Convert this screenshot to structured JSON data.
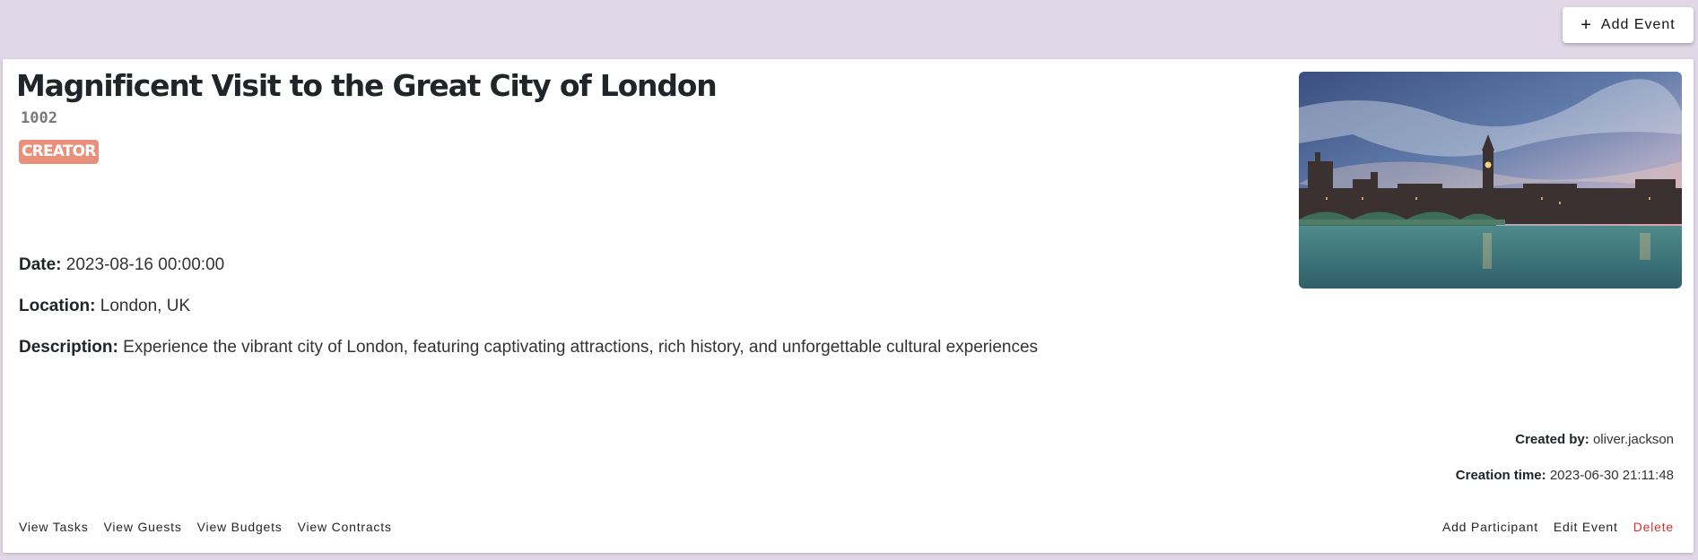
{
  "toolbar": {
    "add_event_icon": "plus-icon",
    "add_event_label": "Add Event"
  },
  "event": {
    "title": "Magnificent Visit to the Great City of London",
    "id": "1002",
    "role_badge": "CREATOR",
    "image_subject": "london-skyline-westminster-photo",
    "date_label": "Date:",
    "date_value": "2023-08-16 00:00:00",
    "location_label": "Location:",
    "location_value": "London, UK",
    "description_label": "Description:",
    "description_value": "Experience the vibrant city of London, featuring captivating attractions, rich history, and unforgettable cultural experiences",
    "created_by_label": "Created by:",
    "created_by_value": "oliver.jackson",
    "creation_time_label": "Creation time:",
    "creation_time_value": "2023-06-30 21:11:48"
  },
  "actions": {
    "left": [
      "View Tasks",
      "View Guests",
      "View Budgets",
      "View Contracts"
    ],
    "right": [
      "Add Participant",
      "Edit Event",
      "Delete"
    ]
  },
  "colors": {
    "page_background": "#e2d7e6",
    "badge_background": "#e8907b",
    "delete_color": "#d32f2f"
  }
}
